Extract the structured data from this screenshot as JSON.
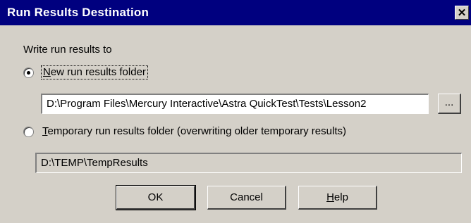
{
  "window": {
    "title": "Run Results Destination",
    "close_icon": "close-icon"
  },
  "section_label": "Write run results to",
  "option_new": {
    "label_prefix": "",
    "label_hotkey": "N",
    "label_rest": "ew run results folder",
    "selected": true,
    "path": "D:\\Program Files\\Mercury Interactive\\Astra QuickTest\\Tests\\Lesson2",
    "browse_label": "..."
  },
  "option_temp": {
    "label_hotkey": "T",
    "label_rest": "emporary run results folder (overwriting older temporary results)",
    "selected": false,
    "path": "D:\\TEMP\\TempResults"
  },
  "buttons": {
    "ok": "OK",
    "cancel": "Cancel",
    "help_hotkey": "H",
    "help_rest": "elp"
  },
  "colors": {
    "title_bar": "#00007f",
    "face": "#d4d0c8"
  }
}
